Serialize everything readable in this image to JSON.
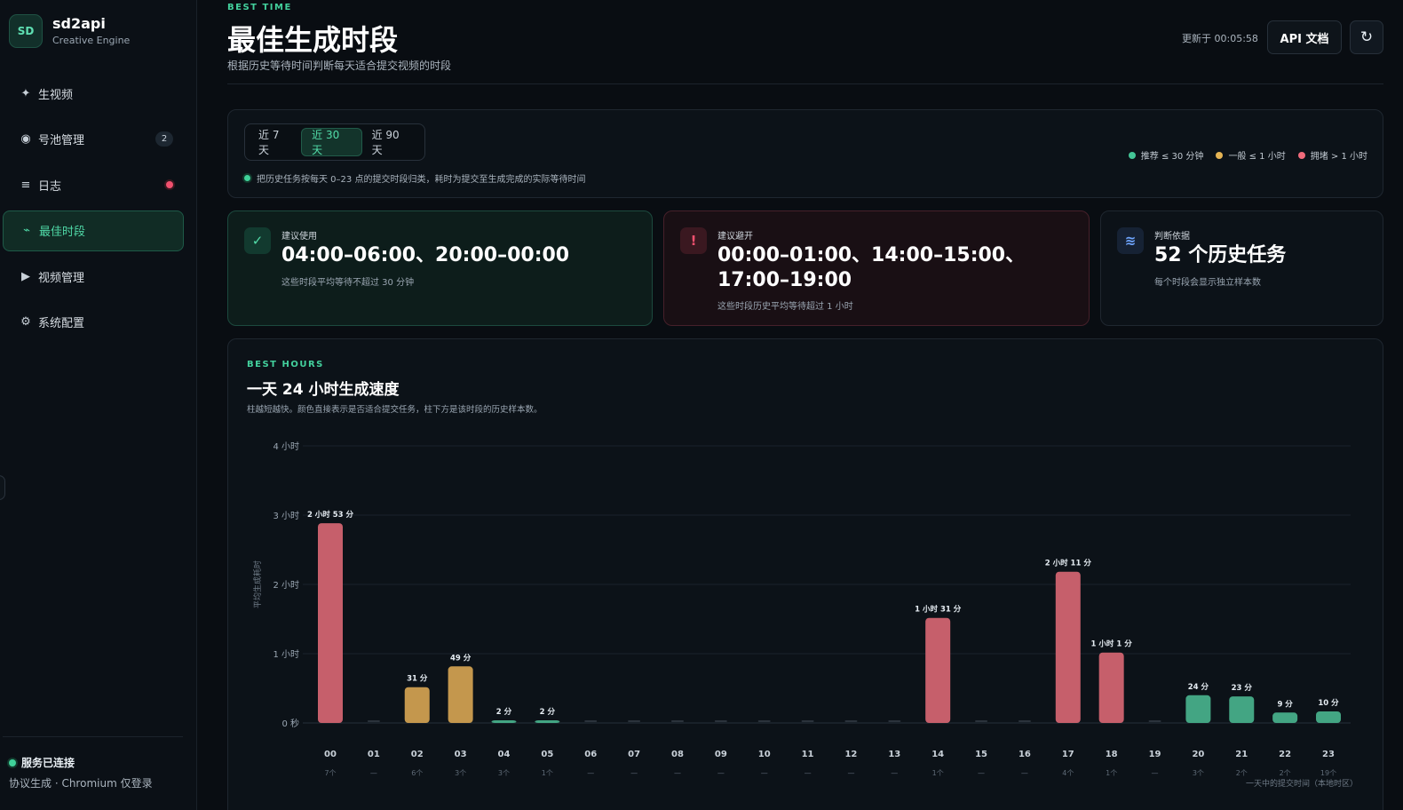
{
  "sidebar": {
    "logo": "SD",
    "app_name": "sd2api",
    "app_sub": "Creative Engine",
    "items": [
      {
        "label": "生视频",
        "icon": "sparkle-icon",
        "glyph": "✦"
      },
      {
        "label": "号池管理",
        "icon": "pool-icon",
        "glyph": "◉",
        "badge": "2"
      },
      {
        "label": "日志",
        "icon": "list-icon",
        "glyph": "≡",
        "dot": true
      },
      {
        "label": "最佳时段",
        "icon": "trend-icon",
        "glyph": "⌁",
        "active": true
      },
      {
        "label": "视频管理",
        "icon": "play-icon",
        "glyph": "▶"
      },
      {
        "label": "系统配置",
        "icon": "gear-icon",
        "glyph": "⚙"
      }
    ],
    "status_title": "服务已连接",
    "status_desc": "协议生成 · Chromium 仅登录"
  },
  "header": {
    "eyebrow": "BEST TIME",
    "title": "最佳生成时段",
    "subtitle": "根据历史等待时间判断每天适合提交视频的时段",
    "updated": "更新于 00:05:58",
    "api_button": "API 文档",
    "refresh_glyph": "↻"
  },
  "filters": {
    "ranges": [
      {
        "label": "近 7 天",
        "active": false
      },
      {
        "label": "近 30 天",
        "active": true
      },
      {
        "label": "近 90 天",
        "active": false
      }
    ],
    "hint": "把历史任务按每天 0–23 点的提交时段归类，耗时为提交至生成完成的实际等待时间",
    "legend": [
      {
        "label": "推荐 ≤ 30 分钟",
        "color": "#43c596"
      },
      {
        "label": "一般 ≤ 1 小时",
        "color": "#e5b454"
      },
      {
        "label": "拥堵 > 1 小时",
        "color": "#f06b7b"
      }
    ]
  },
  "cards": {
    "recommend": {
      "label": "建议使用",
      "value": "04:00–06:00、20:00–00:00",
      "desc": "这些时段平均等待不超过 30 分钟",
      "glyph": "✓"
    },
    "avoid": {
      "label": "建议避开",
      "value": "00:00–01:00、14:00–15:00、17:00–19:00",
      "desc": "这些时段历史平均等待超过 1 小时",
      "glyph": "!"
    },
    "basis": {
      "label": "判断依据",
      "value": "52 个历史任务",
      "desc": "每个时段会显示独立样本数",
      "glyph": "≋"
    }
  },
  "chart_section": {
    "eyebrow": "BEST HOURS",
    "title": "一天 24 小时生成速度",
    "subtitle": "柱越短越快。颜色直接表示是否适合提交任务，柱下方是该时段的历史样本数。"
  },
  "chart_data": {
    "type": "bar",
    "ylabel": "平均生成耗时",
    "xlabel": "一天中的提交时间（本地时区）",
    "y_unit": "minutes",
    "ylim": [
      0,
      240
    ],
    "y_ticks": [
      {
        "value": 0,
        "label": "0 秒"
      },
      {
        "value": 60,
        "label": "1 小时"
      },
      {
        "value": 120,
        "label": "2 小时"
      },
      {
        "value": 180,
        "label": "3 小时"
      },
      {
        "value": 240,
        "label": "4 小时"
      }
    ],
    "grid": true,
    "categories": [
      "00",
      "01",
      "02",
      "03",
      "04",
      "05",
      "06",
      "07",
      "08",
      "09",
      "10",
      "11",
      "12",
      "13",
      "14",
      "15",
      "16",
      "17",
      "18",
      "19",
      "20",
      "21",
      "22",
      "23"
    ],
    "values": [
      173,
      null,
      31,
      49,
      2,
      2,
      null,
      null,
      null,
      null,
      null,
      null,
      null,
      null,
      91,
      null,
      null,
      131,
      61,
      null,
      24,
      23,
      9,
      10
    ],
    "value_labels": [
      "2 小时 53 分",
      "",
      "31 分",
      "49 分",
      "2 分",
      "2 分",
      "",
      "",
      "",
      "",
      "",
      "",
      "",
      "",
      "1 小时 31 分",
      "",
      "",
      "2 小时 11 分",
      "1 小时 1 分",
      "",
      "24 分",
      "23 分",
      "9 分",
      "10 分"
    ],
    "samples": [
      "7个",
      "—",
      "6个",
      "3个",
      "3个",
      "1个",
      "—",
      "—",
      "—",
      "—",
      "—",
      "—",
      "—",
      "—",
      "1个",
      "—",
      "—",
      "4个",
      "1个",
      "—",
      "3个",
      "2个",
      "2个",
      "19个"
    ],
    "levels": [
      "busy",
      "none",
      "normal",
      "normal",
      "good",
      "good",
      "none",
      "none",
      "none",
      "none",
      "none",
      "none",
      "none",
      "none",
      "busy",
      "none",
      "none",
      "busy",
      "busy",
      "none",
      "good",
      "good",
      "good",
      "good"
    ],
    "colors": {
      "good": "#43a583",
      "normal": "#c4974d",
      "busy": "#c65f6b",
      "none": "#2b333c"
    }
  }
}
